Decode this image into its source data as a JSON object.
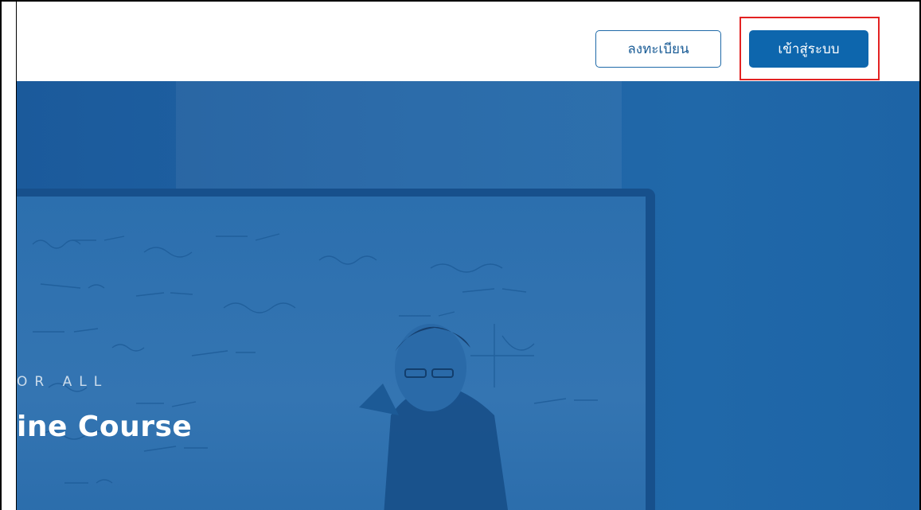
{
  "header": {
    "register_label": "ลงทะเบียน",
    "login_label": "เข้าสู่ระบบ"
  },
  "hero": {
    "tagline": "OR ALL",
    "headline": "ine Course"
  },
  "colors": {
    "primary": "#0d66ad",
    "hero_bg": "#1f62a4",
    "highlight": "#e32222"
  }
}
